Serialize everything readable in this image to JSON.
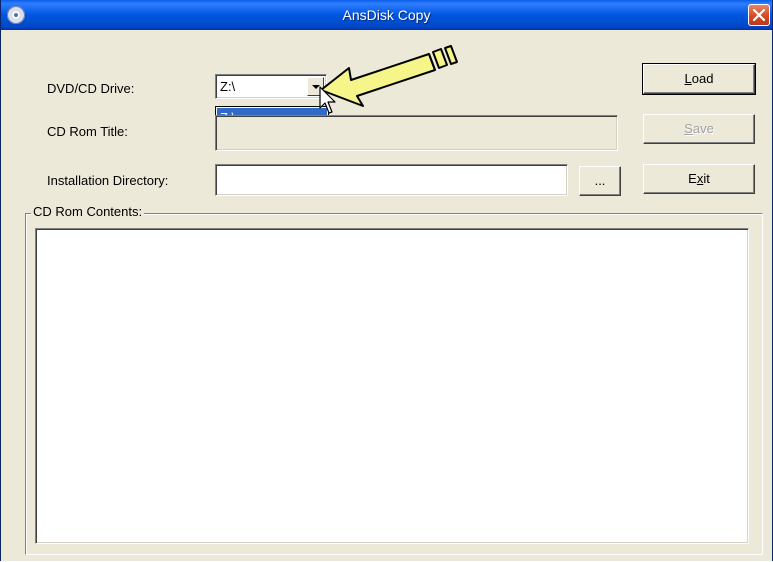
{
  "window": {
    "title": "AnsDisk Copy",
    "icon": "cd-disc-icon",
    "close_icon": "close-x-icon"
  },
  "form": {
    "drive_label": "DVD/CD Drive:",
    "drive_value": "Z:\\",
    "drive_options": [
      "Z:\\"
    ],
    "title_label": "CD Rom Title:",
    "title_value": "",
    "install_label": "Installation Directory:",
    "install_value": "",
    "browse_label": "...",
    "contents_label": "CD Rom Contents:"
  },
  "buttons": {
    "load_mnemonic": "L",
    "load_rest": "oad",
    "save_mnemonic": "S",
    "save_rest": "ave",
    "exit_first": "E",
    "exit_mnemonic": "x",
    "exit_rest": "it"
  },
  "colors": {
    "titlebar": "#0054e3",
    "face": "#ece9d8",
    "selection": "#316ac5",
    "callout_arrow": "#f5f589"
  }
}
